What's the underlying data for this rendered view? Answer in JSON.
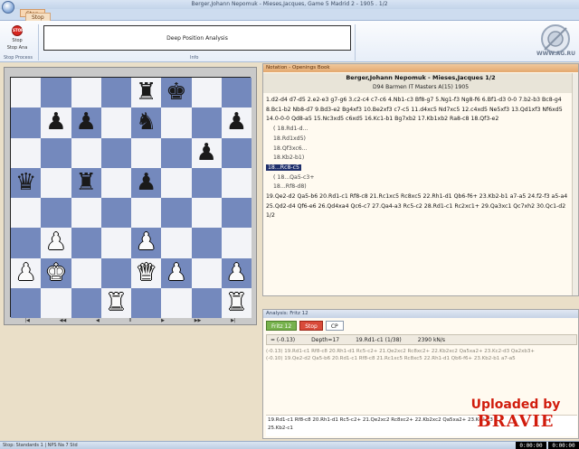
{
  "window": {
    "title": "Berger,Johann Nepomuk - Mieses,Jacques, Game 5 Madrid 2 - 1905 . 1/2",
    "tabs": [
      "Stop",
      "Stop"
    ]
  },
  "ribbon": {
    "stop_label": "Stop",
    "stop_sublabel": "Stop Ana",
    "group_left": "Stop Process",
    "group_right": "Info",
    "deep_label": "Deep Position Analysis",
    "logo_text": "WWW.AG.RU"
  },
  "board": {
    "position": [
      [
        "",
        "",
        "",
        "",
        "bR",
        "bK",
        "",
        ""
      ],
      [
        "",
        "bP",
        "bP",
        "",
        "bN",
        "",
        "",
        "bP"
      ],
      [
        "",
        "",
        "",
        "",
        "",
        "",
        "bP",
        ""
      ],
      [
        "bQ",
        "",
        "bR",
        "",
        "bP",
        "",
        "",
        ""
      ],
      [
        "",
        "",
        "",
        "",
        "",
        "",
        "",
        ""
      ],
      [
        "",
        "wP",
        "",
        "",
        "wP",
        "",
        "",
        ""
      ],
      [
        "wP",
        "wK",
        "",
        "",
        "wQ",
        "wP",
        "",
        "wP"
      ],
      [
        "",
        "",
        "",
        "wR",
        "",
        "",
        "",
        "wR"
      ]
    ],
    "rank_marks": [
      "",
      "",
      "",
      "",
      "",
      "",
      "",
      ""
    ],
    "nav_buttons": [
      "|◀",
      "◀◀",
      "◀",
      "II",
      "▶",
      "▶▶",
      "▶|"
    ]
  },
  "notation": {
    "header": "Notation - Openings Book",
    "players": "Berger,Johann Nepomuk - Mieses,Jacques  1/2",
    "event": "D94 Barmen IT Masters A(15) 1905",
    "moves_before": "1.d2-d4 d7-d5 2.e2-e3 g7-g6 3.c2-c4 c7-c6 4.Nb1-c3 Bf8-g7 5.Ng1-f3 Ng8-f6 6.Bf1-d3 0-0 7.b2-b3 Bc8-g4 8.Bc1-b2 Nb8-d7 9.Bd3-e2 Bg4xf3 10.Be2xf3 c7-c5 11.d4xc5 Nd7xc5 12.c4xd5 Ne5xf3 13.Qd1xf3 Nf6xd5 14.0-0-0 Qd8-a5 15.Nc3xd5 c6xd5 16.Kc1-b1 Bg7xb2 17.Kb1xb2 Ra8-c8 18.Qf3-e2",
    "variations": [
      "( 18.Rd1-d...",
      "18.Rd1xd5)",
      "18.Qf3xc6...",
      "18.Kb2-b1)"
    ],
    "current_move": "18...Rc8-c5",
    "variations_after": [
      "( 18...Qa5-c3+",
      "18...Rf8-d8)"
    ],
    "moves_after": "19.Qe2-d2 Qa5-b6 20.Rd1-c1 Rf8-c8 21.Rc1xc5 Rc8xc5 22.Rh1-d1 Qb6-f6+ 23.Kb2-b1 a7-a5 24.f2-f3 a5-a4 25.Qd2-d4 Qf6-e6 26.Qd4xa4 Qc6-c7 27.Qa4-a3 Rc5-c2 28.Rd1-c1 Rc2xc1+ 29.Qa3xc1 Qc7xh2 30.Qc1-d2",
    "result": "1/2"
  },
  "engine": {
    "header": "Analysis: Fritz 12",
    "tabs": [
      "Fritz 12",
      "Stop",
      "CP"
    ],
    "score": "= (-0.13)",
    "depth": "Depth=17",
    "current": "19.Rd1-c1 (1/38)",
    "speed": "2390 kN/s",
    "lines": [
      "(-0.13)  19.Rd1-c1 Rf8-c8 20.Rh1-d1 Rc5-c2+ 21.Qe2xc2 Rc8xc2+ 22.Kb2xc2 Qa5xa2+ 23.Kc2-d3 Qa2xb3+",
      "(-0.10)  19.Qe2-d2 Qa5-b6 20.Rd1-c1 Rf8-c8 21.Rc1xc5 Rc8xc5 22.Rh1-d1 Qb6-f6+ 23.Kb2-b1 a7-a5"
    ],
    "bottom_line": "19.Rd1-c1 Rf8-c8 20.Rh1-d1 Rc5-c2+ 21.Qe2xc2 Rc8xc2+ 22.Kb2xc2 Qa5xa2+ 23.Kc2-d3",
    "bottom_line2": "25.Kb2-c1"
  },
  "watermark": {
    "line1": "Uploaded by",
    "line2": "BRAVIE"
  },
  "status": {
    "text": "Stop: Standards 1 | NPS  Na 7  Std",
    "clocks": [
      "0:00:00",
      "0:00:00"
    ]
  }
}
